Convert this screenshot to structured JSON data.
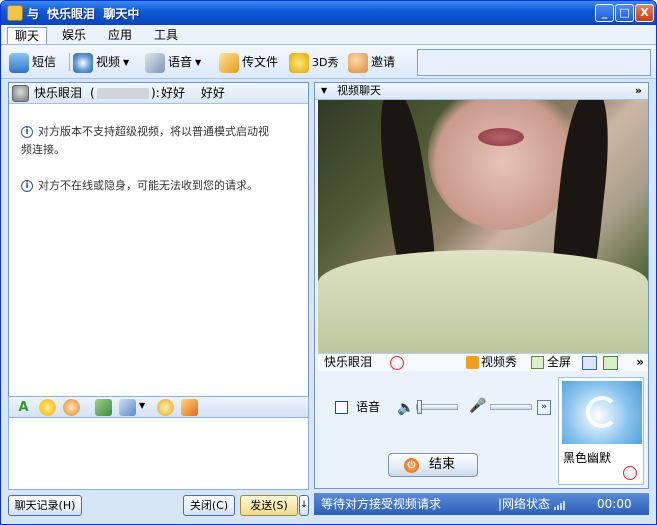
{
  "window": {
    "title_prefix": "与",
    "title_name": "快乐眼泪",
    "title_suffix": "聊天中",
    "controls": [
      "_",
      "□",
      "X"
    ]
  },
  "menu": [
    {
      "label": "聊天",
      "active": true
    },
    {
      "label": "娱乐",
      "active": false
    },
    {
      "label": "应用",
      "active": false
    },
    {
      "label": "工具",
      "active": false
    }
  ],
  "toolbar": {
    "sms": "短信",
    "video": "视频",
    "voice": "语音",
    "send_file": "传文件",
    "show3d": "3D秀",
    "invite": "邀请"
  },
  "chat": {
    "contact_name": "快乐眼泪",
    "paren_open": "(",
    "paren_close": "):",
    "status": "好好　 好好",
    "messages": [
      "对方版本不支持超级视频，将以普通模式启动视",
      "频连接。",
      "对方不在线或隐身，可能无法收到您的请求。"
    ]
  },
  "bottom_buttons": {
    "history": "聊天记录(H)",
    "close": "关闭(C)",
    "send": "发送(S)",
    "send_arrow": "↓"
  },
  "video": {
    "header": "视频聊天",
    "header_more": "»",
    "name": "快乐眼泪",
    "video_show": "视频秀",
    "fullscreen": "全屏",
    "bar_more": "»",
    "voice_label": "语音",
    "end_label": "结束",
    "show_name": "黑色幽默",
    "more_btn": "»"
  },
  "status": {
    "waiting": "等待对方接受视频请求",
    "network": "|网络状态",
    "timer": "00:00"
  },
  "colors": {
    "title_bar": "#0f5bd8",
    "panel_border": "#6f95cc",
    "background": "#d6e6f7",
    "status_bar": "#2c5fb8"
  }
}
